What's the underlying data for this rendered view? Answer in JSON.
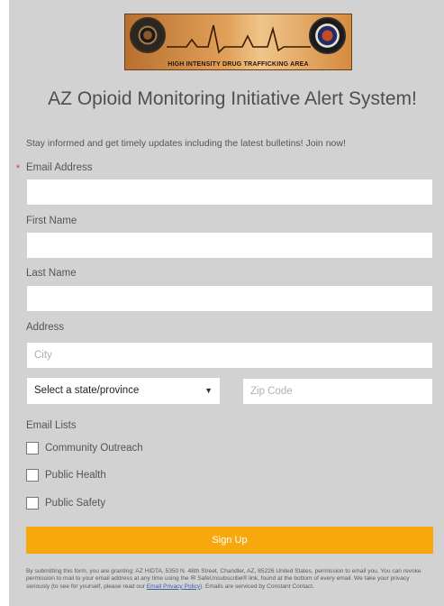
{
  "banner": {
    "text": "HIGH INTENSITY DRUG TRAFFICKING AREA"
  },
  "title": "AZ Opioid Monitoring Initiative Alert System!",
  "intro": "Stay informed and get timely updates including the latest bulletins! Join now!",
  "required_marker": "*",
  "fields": {
    "email_label": "Email Address",
    "first_name_label": "First Name",
    "last_name_label": "Last Name",
    "address_label": "Address",
    "city_placeholder": "City",
    "state_selected": "Select a state/province",
    "zip_placeholder": "Zip Code"
  },
  "email_lists": {
    "label": "Email Lists",
    "items": [
      "Community Outreach",
      "Public Health",
      "Public Safety"
    ]
  },
  "signup_label": "Sign Up",
  "footer": {
    "part1": "By submitting this form, you are granting: AZ HIDTA, 5350 N. 48th Street, Chandler, AZ, 85226 United States, permission to email you. You can revoke permission to mail to your email address at any time using the ",
    "safeunsubscribe": " SafeUnsubscribe® link, found at the bottom of every email. We take your privacy seriously (to see for yourself, please read our ",
    "privacy_link": "Email Privacy Policy",
    "part2": "). Emails are serviced by Constant Contact."
  },
  "icons": {
    "envelope": "envelope-icon",
    "dropdown": "chevron-down-icon"
  },
  "colors": {
    "accent": "#f7a80d",
    "background": "#d2d2d2",
    "required": "#e33333"
  }
}
